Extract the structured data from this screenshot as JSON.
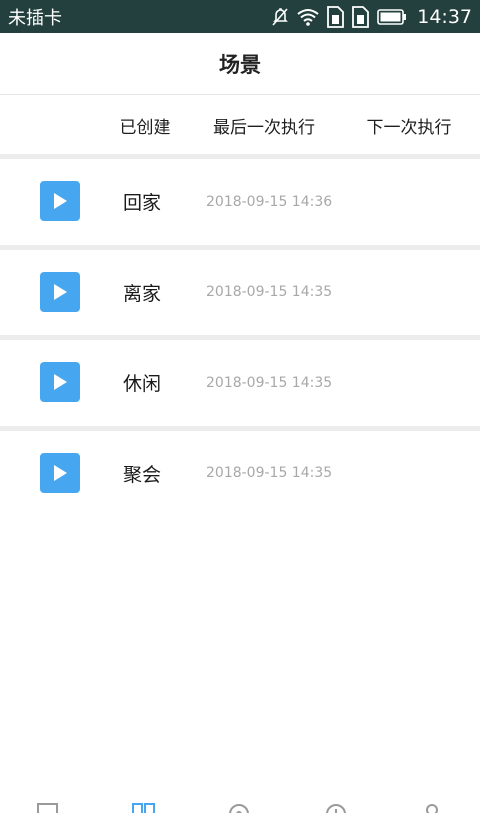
{
  "status_bar": {
    "carrier": "未插卡",
    "time": "14:37",
    "icons": [
      "mute-icon",
      "wifi-icon",
      "sim1-icon",
      "sim2-icon",
      "battery-icon"
    ]
  },
  "header": {
    "title": "场景"
  },
  "tabs": [
    {
      "label": "已创建"
    },
    {
      "label": "最后一次执行"
    },
    {
      "label": "下一次执行"
    }
  ],
  "scenes": [
    {
      "name": "回家",
      "last_run": "2018-09-15 14:36"
    },
    {
      "name": "离家",
      "last_run": "2018-09-15 14:35"
    },
    {
      "name": "休闲",
      "last_run": "2018-09-15 14:35"
    },
    {
      "name": "聚会",
      "last_run": "2018-09-15 14:35"
    }
  ],
  "bottom_nav": {
    "items": [
      "home-icon",
      "scenes-icon",
      "center-icon",
      "history-icon",
      "profile-icon"
    ],
    "active_index": 1
  },
  "colors": {
    "status_bar_bg": "#23403e",
    "accent": "#46a7f0",
    "divider": "#ececec",
    "time_text": "#a8a8a8"
  }
}
